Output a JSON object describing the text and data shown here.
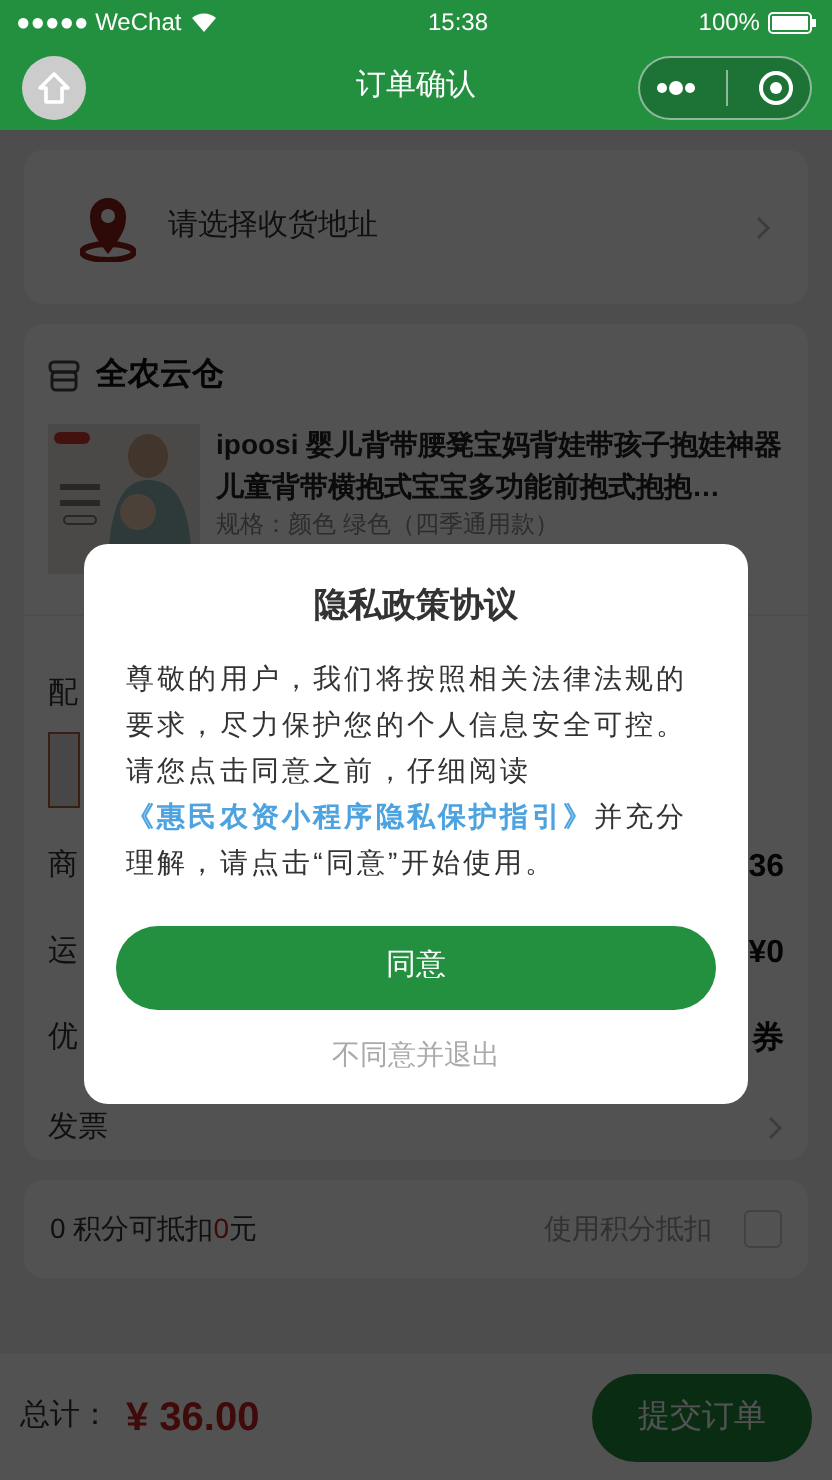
{
  "status_bar": {
    "carrier": "●●●●● WeChat",
    "time": "15:38",
    "battery": "100%"
  },
  "nav": {
    "title": "订单确认"
  },
  "address": {
    "prompt": "请选择收货地址"
  },
  "store": {
    "name": "全农云仓",
    "product": {
      "title": "ipoosi 婴儿背带腰凳宝妈背娃带孩子抱娃神器儿童背带横抱式宝宝多功能前抱式抱抱…",
      "spec": "规格：颜色 绿色（四季通用款）"
    },
    "rows": [
      {
        "kind": "label",
        "label": "配"
      },
      {
        "kind": "thumb"
      },
      {
        "kind": "value",
        "label": "商",
        "value": "36"
      },
      {
        "kind": "value",
        "label": "运",
        "value": "¥0"
      },
      {
        "kind": "value",
        "label": "优",
        "value": "券"
      },
      {
        "kind": "link",
        "label": "发票"
      }
    ]
  },
  "points": {
    "text": "0 积分可抵扣",
    "deduct": "0",
    "unit": "元",
    "label": "使用积分抵扣",
    "checked": false
  },
  "footer": {
    "label": "总计：",
    "total": "¥ 36.00",
    "submit": "提交订单"
  },
  "modal": {
    "title": "隐私政策协议",
    "body_before": "尊敬的用户，我们将按照相关法律法规的要求，尽力保护您的个人信息安全可控。请您点击同意之前，仔细阅读",
    "link": "《惠民农资小程序隐私保护指引》",
    "body_after": "并充分理解，请点击“同意”开始使用。",
    "agree": "同意",
    "decline": "不同意并退出"
  }
}
